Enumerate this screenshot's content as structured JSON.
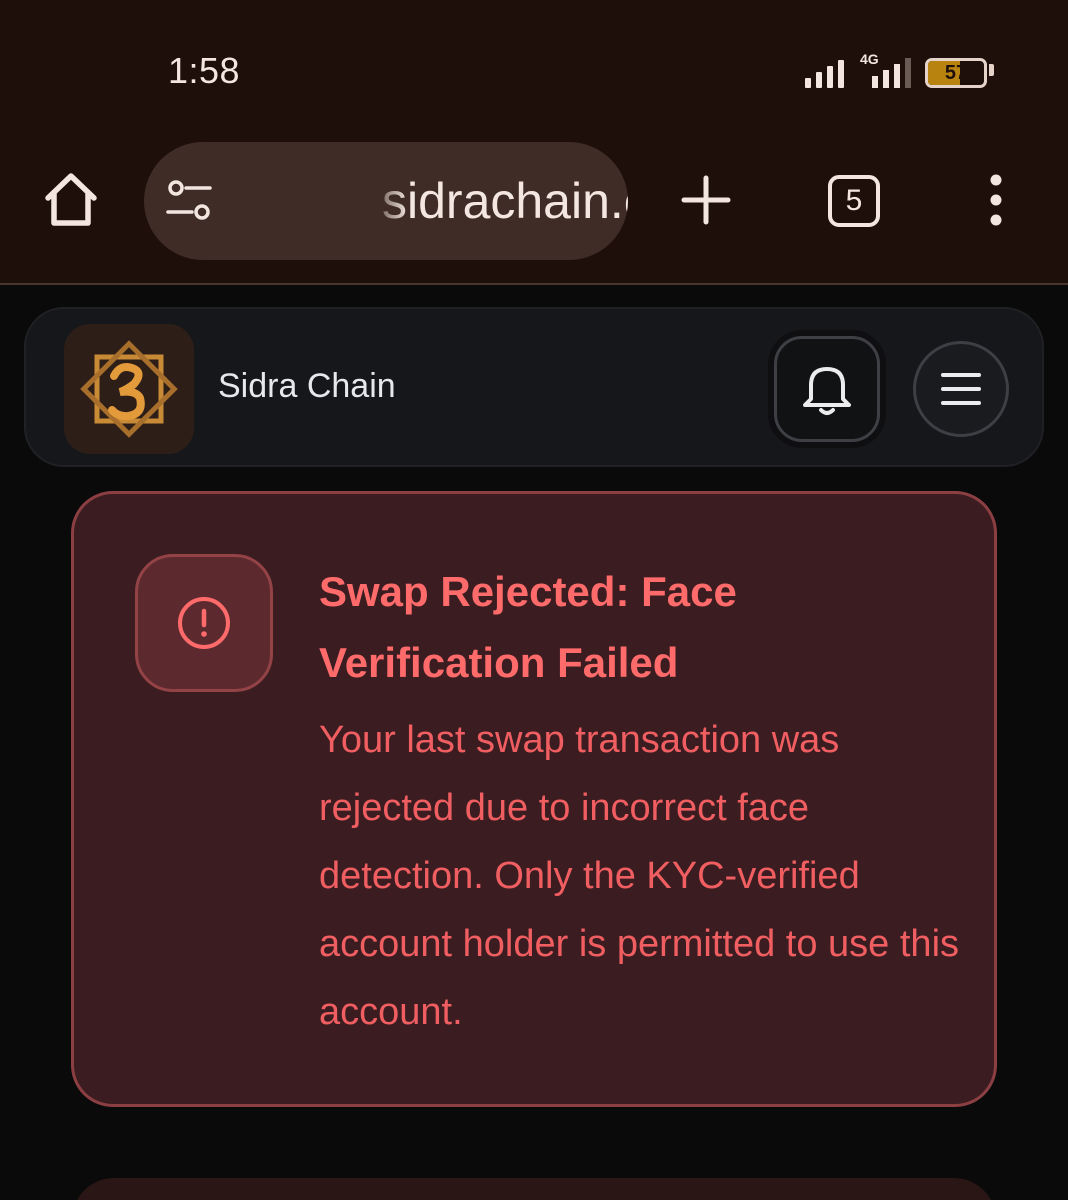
{
  "status_bar": {
    "time": "1:58",
    "network": "4G",
    "battery": "57",
    "battery_fraction": 0.57
  },
  "browser": {
    "url": "sidrachain.com",
    "tab_count": "5"
  },
  "site": {
    "name": "Sidra Chain"
  },
  "alert": {
    "title": "Swap Rejected: Face Verification Failed",
    "message": "Your last swap transaction was rejected due to incorrect face detection. Only the KYC-verified account holder is permitted to use this account."
  },
  "icons": {
    "home": "home-icon",
    "site_settings": "tune-icon",
    "new_tab": "plus-icon",
    "menu": "more-vert-icon",
    "notifications": "bell-icon",
    "nav_menu": "hamburger-icon",
    "alert": "alert-circle-icon"
  },
  "colors": {
    "chrome_bg": "#1e0f0b",
    "url_bar_bg": "#3f2c26",
    "page_bg": "#0a0a0b",
    "alert_bg": "#3b1d21",
    "alert_border": "#8c3f43",
    "alert_text": "#ff6b6b",
    "logo_gold": "#d98c2b"
  }
}
